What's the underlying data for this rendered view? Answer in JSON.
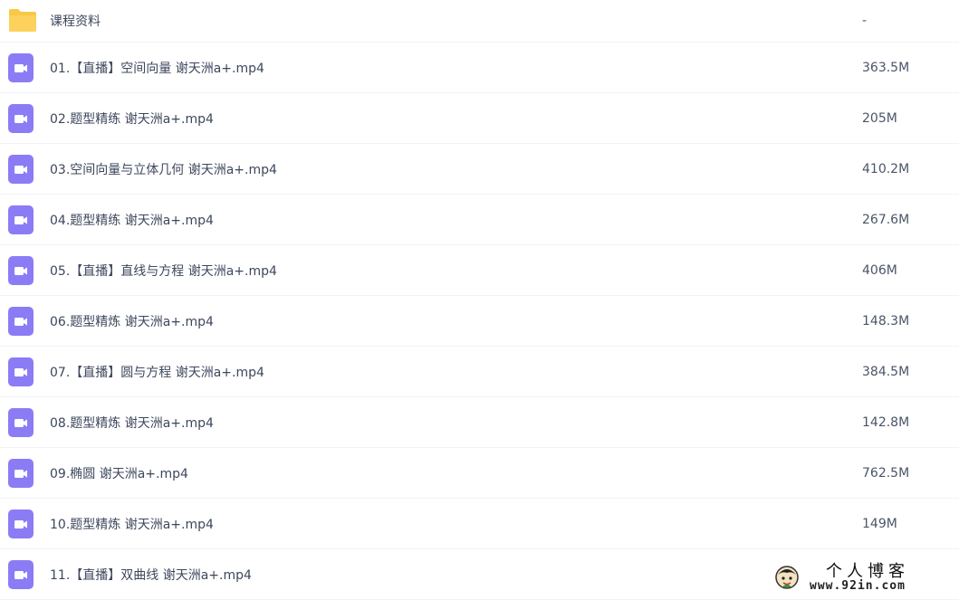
{
  "files": [
    {
      "type": "folder",
      "name": "课程资料",
      "size": "-"
    },
    {
      "type": "video",
      "name": "01.【直播】空间向量 谢天洲a+.mp4",
      "size": "363.5M"
    },
    {
      "type": "video",
      "name": "02.题型精练 谢天洲a+.mp4",
      "size": "205M"
    },
    {
      "type": "video",
      "name": "03.空间向量与立体几何 谢天洲a+.mp4",
      "size": "410.2M"
    },
    {
      "type": "video",
      "name": "04.题型精练 谢天洲a+.mp4",
      "size": "267.6M"
    },
    {
      "type": "video",
      "name": "05.【直播】直线与方程 谢天洲a+.mp4",
      "size": "406M"
    },
    {
      "type": "video",
      "name": "06.题型精炼 谢天洲a+.mp4",
      "size": "148.3M"
    },
    {
      "type": "video",
      "name": "07.【直播】圆与方程 谢天洲a+.mp4",
      "size": "384.5M"
    },
    {
      "type": "video",
      "name": "08.题型精炼 谢天洲a+.mp4",
      "size": "142.8M"
    },
    {
      "type": "video",
      "name": "09.椭圆 谢天洲a+.mp4",
      "size": "762.5M"
    },
    {
      "type": "video",
      "name": "10.题型精炼 谢天洲a+.mp4",
      "size": "149M"
    },
    {
      "type": "video",
      "name": "11.【直播】双曲线 谢天洲a+.mp4",
      "size": ""
    }
  ],
  "icons": {
    "folder": "folder-icon",
    "video": "video-file-icon"
  },
  "colors": {
    "folder": "#fcd25d",
    "video": "#8b7cf6",
    "text": "#3d475c"
  },
  "watermark": {
    "title": "个人博客",
    "url": "www.92in.com"
  }
}
